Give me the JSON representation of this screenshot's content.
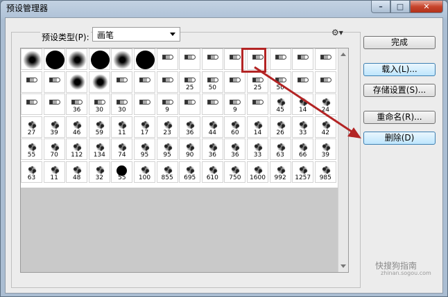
{
  "window": {
    "title": "预设管理器"
  },
  "caption": {
    "min": "–",
    "max": "□",
    "close": "✕"
  },
  "preset": {
    "label": "预设类型(P):",
    "value": "画笔"
  },
  "buttons": {
    "done": "完成",
    "load": "载入(L)...",
    "save": "存储设置(S)...",
    "rename": "重命名(R)...",
    "delete": "删除(D)"
  },
  "watermark": {
    "main": "快搜狗指南",
    "sub": "zhinan.sogou.com"
  },
  "brush_rows": [
    [
      "",
      "",
      "",
      "",
      "",
      "",
      "",
      "",
      "",
      "",
      "",
      "",
      "",
      ""
    ],
    [
      "",
      "",
      "",
      "",
      "",
      "",
      "",
      "25",
      "50",
      "",
      "25",
      "50",
      "",
      ""
    ],
    [
      "",
      "",
      "36",
      "30",
      "30",
      "",
      "9",
      "",
      "",
      "9",
      "",
      "45",
      "14",
      "24"
    ],
    [
      "27",
      "39",
      "46",
      "59",
      "11",
      "17",
      "23",
      "36",
      "44",
      "60",
      "14",
      "26",
      "33",
      "42"
    ],
    [
      "55",
      "70",
      "112",
      "134",
      "74",
      "95",
      "95",
      "90",
      "36",
      "36",
      "33",
      "63",
      "66",
      "39"
    ],
    [
      "63",
      "11",
      "48",
      "32",
      "55",
      "100",
      "855",
      "695",
      "610",
      "750",
      "1600",
      "992",
      "1257",
      "985"
    ]
  ]
}
